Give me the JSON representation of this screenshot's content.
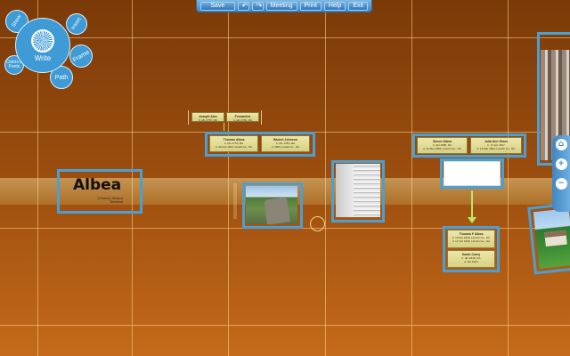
{
  "toolbar": {
    "save_label": "Save",
    "undo_icon": "undo-icon",
    "redo_icon": "redo-icon",
    "meeting_label": "Meeting",
    "print_label": "Print",
    "help_label": "Help",
    "exit_label": "Exit"
  },
  "bubble_menu": {
    "main_label": "Write",
    "show_label": "Show",
    "insert_label": "Insert",
    "frame_label": "Frame",
    "path_label": "Path",
    "color_label": "Colors & Fonts"
  },
  "zoom": {
    "home_icon": "home-icon",
    "zoom_in_icon": "zoom-in-icon",
    "zoom_out_icon": "zoom-out-icon"
  },
  "title": {
    "main": "Albea",
    "sub": "A Family History Timeline"
  },
  "people": {
    "joseph": {
      "name": "Joseph Alex",
      "line1": "b. abt 1756, MA"
    },
    "fernandes": {
      "name": "Fernandes",
      "line1": "b. abt 1760, MA"
    },
    "thomas": {
      "name": "Thomas Albea",
      "line1": "b. Abt 1778, MA",
      "line2": "d. 30 Feb 1844, Iredell Co., NC"
    },
    "rachel": {
      "name": "Rachel Johnson",
      "line1": "b. Abt 1782, MA",
      "line2": "d. 1863, Iredell Co., NC"
    },
    "simon": {
      "name": "Simon Albea",
      "line1": "b. Abt 1808, NC",
      "line2": "d. 12 Mar 1856, Lincoln Co., NC"
    },
    "julia": {
      "name": "Julia Ann Glass",
      "line1": "b. 17 Apr 1817",
      "line2": "d. 13 Mar 1894, Lincoln Co., NC"
    },
    "thomas_f": {
      "name": "Thomas F Albea",
      "line1": "b. 19 Oct 1840, Lincoln Co., NC",
      "line2": "d. 17 Oct 1926, Lincoln Co., GA"
    },
    "sarah": {
      "name": "Sarah Carey",
      "line1": "b. abt 1848, GA",
      "line2": "d. bef 1924"
    }
  },
  "colors": {
    "frame": "#4a9fd4",
    "toolbar": "#3f86c4",
    "grid": "#ffd78c"
  }
}
